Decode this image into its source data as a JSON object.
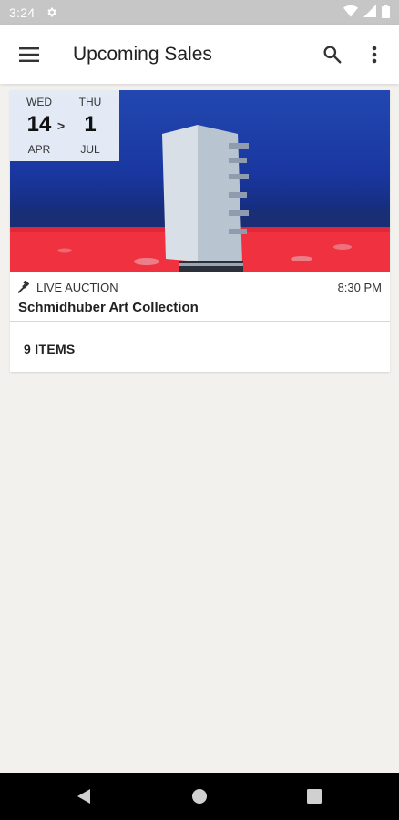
{
  "status_bar": {
    "time": "3:24",
    "icons": [
      "settings-gear-icon",
      "wifi-icon",
      "cell-signal-icon",
      "battery-icon"
    ]
  },
  "app_bar": {
    "title": "Upcoming Sales",
    "menu_icon": "hamburger-menu-icon",
    "search_icon": "search-icon",
    "more_icon": "more-vertical-icon"
  },
  "sale_card": {
    "date_range": {
      "start": {
        "weekday": "WED",
        "day": "14",
        "month": "APR"
      },
      "separator": ">",
      "end": {
        "weekday": "THU",
        "day": "1",
        "month": "JUL"
      }
    },
    "type_icon": "gavel-icon",
    "type_label": "LIVE AUCTION",
    "time": "8:30 PM",
    "title": "Schmidhuber Art Collection",
    "items_label": "9 ITEMS"
  },
  "nav_bar": {
    "buttons": [
      "back-triangle-icon",
      "home-circle-icon",
      "recents-square-icon"
    ]
  },
  "colors": {
    "app_bar_bg": "#ffffff",
    "page_bg": "#f2f1ee",
    "status_bar_bg": "#c6c6c6",
    "nav_bar_bg": "#000000",
    "artwork_blue": "#1d3fa3",
    "artwork_red": "#f0313f"
  }
}
